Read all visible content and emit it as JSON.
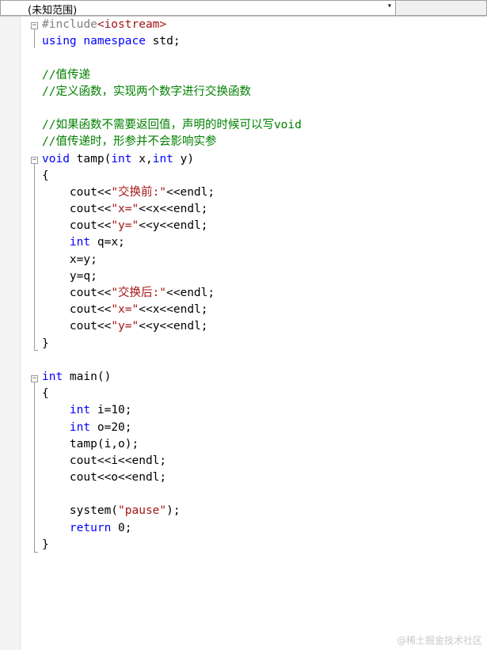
{
  "navbar": {
    "scope": "(未知范围)",
    "dropdown_arrow": "▾"
  },
  "watermark": "@稀土掘金技术社区",
  "code": {
    "l1": {
      "a": "#include",
      "b": "<iostream>"
    },
    "l2": {
      "a": "using namespace",
      "b": " std;"
    },
    "l4": "//值传递",
    "l5": "//定义函数，实现两个数字进行交换函数",
    "l7": "//如果函数不需要返回值，声明的时候可以写void",
    "l8": "//值传递时，形参并不会影响实参",
    "l9": {
      "a": "void",
      "b": " tamp(",
      "c": "int",
      "d": " x,",
      "e": "int",
      "f": " y)"
    },
    "l10": "{",
    "l11": {
      "a": "    cout<<",
      "b": "\"交换前:\"",
      "c": "<<endl;"
    },
    "l12": {
      "a": "    cout<<",
      "b": "\"x=\"",
      "c": "<<x<<endl;"
    },
    "l13": {
      "a": "    cout<<",
      "b": "\"y=\"",
      "c": "<<y<<endl;"
    },
    "l14": {
      "a": "    ",
      "b": "int",
      "c": " q=x;"
    },
    "l15": "    x=y;",
    "l16": "    y=q;",
    "l17": {
      "a": "    cout<<",
      "b": "\"交换后:\"",
      "c": "<<endl;"
    },
    "l18": {
      "a": "    cout<<",
      "b": "\"x=\"",
      "c": "<<x<<endl;"
    },
    "l19": {
      "a": "    cout<<",
      "b": "\"y=\"",
      "c": "<<y<<endl;"
    },
    "l20": "}",
    "l22": {
      "a": "int",
      "b": " main()"
    },
    "l23": "{",
    "l24": {
      "a": "    ",
      "b": "int",
      "c": " i=10;"
    },
    "l25": {
      "a": "    ",
      "b": "int",
      "c": " o=20;"
    },
    "l26": "    tamp(i,o);",
    "l27": "    cout<<i<<endl;",
    "l28": "    cout<<o<<endl;",
    "l30": {
      "a": "    system(",
      "b": "\"pause\"",
      "c": ");"
    },
    "l31": {
      "a": "    ",
      "b": "return",
      "c": " 0;"
    },
    "l32": "}"
  },
  "colors": {
    "keyword": "#0000ff",
    "string": "#a31515",
    "comment": "#008000",
    "preprocessor": "#808080"
  }
}
